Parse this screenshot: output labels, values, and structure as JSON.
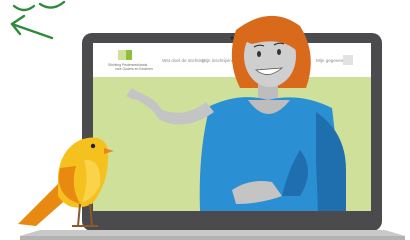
{
  "site_header": {
    "logo_line1": "Stichting Peuterwerklands",
    "logo_line2": "voor Ouders en Kinderen",
    "nav_items": [
      "Wat doet de stichting",
      "Mijn inschrijving"
    ],
    "nav_right": "Mijn gegevens"
  },
  "colors": {
    "screen_bg": "#cfe09a",
    "laptop_frame": "#4b4b4d",
    "laptop_base": "#c9c9c9",
    "arrow_green": "#2f8a3c",
    "bird_yellow": "#f5c11f",
    "bird_orange": "#e88a12",
    "shirt_blue": "#2b8fd3",
    "hair_orange": "#d96a1c",
    "skin_grey": "#c7c7c7"
  },
  "icons": [
    "curved-arrow-icon",
    "bird-illustration",
    "woman-illustration",
    "laptop-illustration",
    "logo-icon"
  ]
}
